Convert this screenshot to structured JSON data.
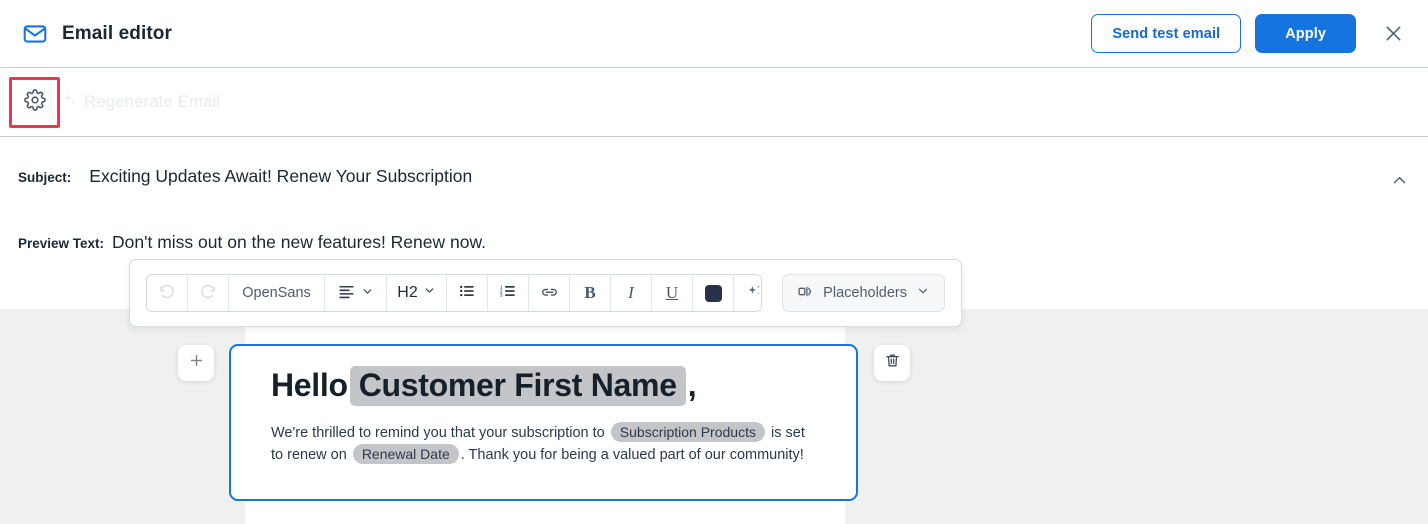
{
  "header": {
    "icon": "mail-icon",
    "title": "Email editor",
    "send_test_label": "Send test email",
    "apply_label": "Apply",
    "close_icon": "close-icon"
  },
  "tool_strip": {
    "settings_icon": "gear-icon",
    "regenerate_icon": "sparkle-icon",
    "regenerate_label": "Regenerate Email",
    "highlight_color": "#f4334f"
  },
  "fields": {
    "subject_label": "Subject:",
    "subject_value": "Exciting Updates Await! Renew Your Subscription",
    "preview_label": "Preview Text:",
    "preview_value": "Don't miss out on the new features! Renew now.",
    "collapse_icon": "chevron-up-icon"
  },
  "toolbar": {
    "undo": {
      "icon": "undo-icon",
      "label": ""
    },
    "redo": {
      "icon": "redo-icon",
      "label": ""
    },
    "font_name": "OpenSans",
    "align": {
      "icon": "align-left-icon",
      "caret": "chevron-down-icon"
    },
    "heading": {
      "label": "H2",
      "caret": "chevron-down-icon"
    },
    "bullet_list": {
      "icon": "bulleted-list-icon"
    },
    "numbered_list": {
      "icon": "numbered-list-icon"
    },
    "link": {
      "icon": "link-icon"
    },
    "bold": {
      "label": "B"
    },
    "italic": {
      "label": "I"
    },
    "underline": {
      "label": "U"
    },
    "text_color": {
      "icon": "color-swatch-icon",
      "value": "#28334a"
    },
    "ai_assist": {
      "icon": "sparkle-icon"
    },
    "placeholders": {
      "icon": "placeholder-icon",
      "label": "Placeholders",
      "caret": "chevron-down-icon"
    }
  },
  "block": {
    "add_icon": "plus-icon",
    "delete_icon": "trash-icon",
    "heading": {
      "prefix": "Hello",
      "placeholder": "Customer First Name",
      "suffix": ","
    },
    "body": {
      "part1": "We're thrilled to remind you that your subscription to",
      "placeholder1": "Subscription Products",
      "part2": "is set to renew on",
      "placeholder2": "Renewal Date",
      "part3": ". Thank you for being a valued part of our community!"
    }
  },
  "colors": {
    "brand_blue": "#1574dd",
    "canvas_bg": "#f0f0f0",
    "placeholder_chip": "#c3c5c9",
    "highlight_red": "#f4334f"
  }
}
